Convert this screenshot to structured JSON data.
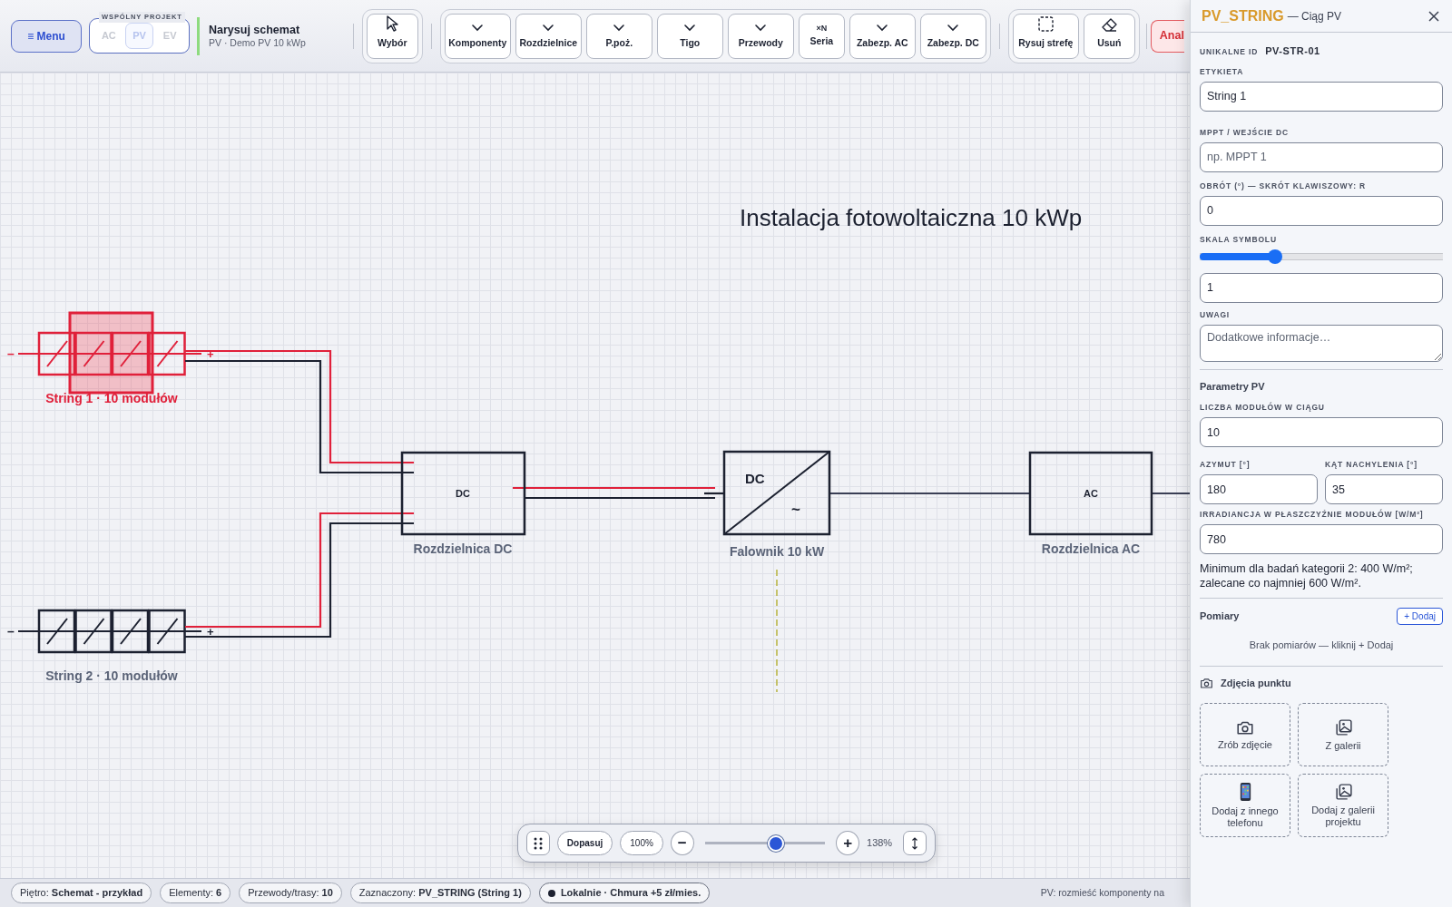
{
  "header": {
    "menu_button": "≡ Menu",
    "project_switch": {
      "label": "WSPÓLNY PROJEKT",
      "disabled": true,
      "options": [
        {
          "label": "AC",
          "selected": false
        },
        {
          "label": "PV",
          "selected": true
        },
        {
          "label": "EV",
          "selected": false
        }
      ]
    },
    "title": "Narysuj schemat",
    "subtitle": "PV · Demo PV 10 kWp",
    "tool_groups": [
      [
        {
          "kind": "pointer",
          "label": "Wybór"
        }
      ],
      [
        {
          "kind": "dropdown",
          "label": "Komponenty"
        },
        {
          "kind": "dropdown",
          "label": "Rozdzielnice"
        },
        {
          "kind": "dropdown",
          "label": "P.poż."
        },
        {
          "kind": "dropdown",
          "label": "Tigo"
        },
        {
          "kind": "dropdown",
          "label": "Przewody"
        },
        {
          "kind": "multiplier",
          "icon_text": "×N",
          "label": "Seria"
        },
        {
          "kind": "dropdown",
          "label": "Zabezp. AC"
        },
        {
          "kind": "dropdown",
          "label": "Zabezp. DC"
        }
      ],
      [
        {
          "kind": "area",
          "label": "Rysuj strefę"
        },
        {
          "kind": "eraser",
          "label": "Usuń"
        }
      ]
    ],
    "analysis_button": "Anal"
  },
  "diagram": {
    "title": "Instalacja fotowoltaiczna 10 kWp",
    "strings": [
      {
        "label": "String 1 · 10 modułów",
        "selected": true,
        "neg": "–",
        "pos": "+"
      },
      {
        "label": "String 2 · 10 modułów",
        "selected": false,
        "neg": "–",
        "pos": "+"
      }
    ],
    "dc_box": {
      "symbol": "DC",
      "label": "Rozdzielnica DC"
    },
    "inverter": {
      "symbol_in": "DC",
      "symbol_out": "~",
      "label": "Falownik 10 kW"
    },
    "ac_box": {
      "symbol": "AC",
      "label": "Rozdzielnica AC"
    }
  },
  "zoom_bar": {
    "fit": "Dopasuj",
    "reset": "100%",
    "minus": "−",
    "plus": "+",
    "level": 0.59,
    "reading": "138%"
  },
  "status_bar": {
    "items": [
      "Piętro: **Schemat - przykład**",
      "Elementy: **6**",
      "Przewody/trasy: **10**",
      "Zaznaczony: **PV_STRING (String 1)**"
    ],
    "sync": "Lokalnie · Chmura +5 zł/mies.",
    "hint": "PV: rozmieść komponenty na"
  },
  "panel": {
    "type_code": "PV_STRING",
    "type_name": "— Ciąg PV",
    "id_label": "UNIKALNE ID",
    "id": "PV-STR-01",
    "fields": [
      {
        "kind": "input",
        "label": "ETYKIETA",
        "value": "String 1"
      },
      {
        "kind": "input",
        "label": "MPPT / WEJŚCIE DC",
        "placeholder": "np. MPPT 1"
      },
      {
        "kind": "input",
        "label": "OBRÓT (°) — SKRÓT KLAWISZOWY: R",
        "value": "0"
      },
      {
        "kind": "slider",
        "label": "SKALA SYMBOLU",
        "level": 0.31
      },
      {
        "kind": "input",
        "value": "1"
      },
      {
        "kind": "textarea",
        "label": "UWAGI",
        "placeholder": "Dodatkowe informacje…"
      }
    ],
    "pv_title": "Parametry PV",
    "pv_fields": [
      {
        "kind": "input",
        "label": "LICZBA MODUŁÓW W CIĄGU",
        "value": "10"
      },
      {
        "kind": "half",
        "label": "AZYMUT [°]",
        "value": "180"
      },
      {
        "kind": "half",
        "label": "KĄT NACHYLENIA [°]",
        "value": "35"
      },
      {
        "kind": "input",
        "label": "IRRADIANCJA W PŁASZCZYŹNIE MODUŁÓW [W/M²]",
        "value": "780"
      }
    ],
    "pv_note": "Minimum dla badań kategorii 2: 400 W/m²; zalecane co najmniej 600 W/m².",
    "measurements": {
      "title": "Pomiary",
      "add_button": "+ Dodaj",
      "empty": "Brak pomiarów — kliknij + Dodaj"
    },
    "photos": {
      "title": "Zdjęcia punktu",
      "tiles": [
        {
          "kind": "camera",
          "label": "Zrób zdjęcie"
        },
        {
          "kind": "gallery",
          "label": "Z galerii"
        },
        {
          "kind": "phone",
          "label": "Dodaj z innego telefonu"
        },
        {
          "kind": "gallery",
          "label": "Dodaj z galerii projektu"
        }
      ]
    }
  }
}
